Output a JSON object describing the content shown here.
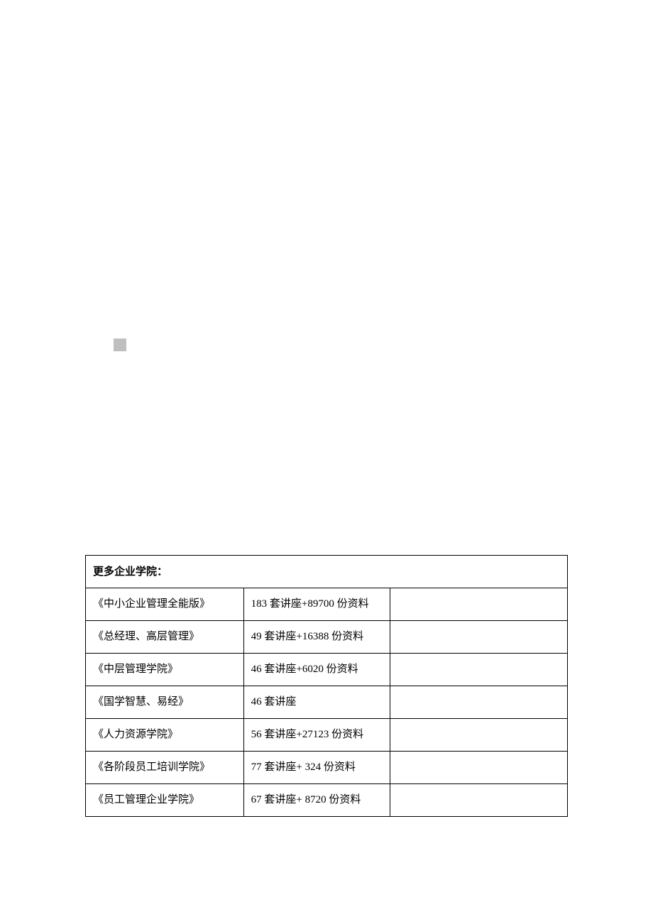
{
  "table": {
    "header": "更多企业学院：",
    "rows": [
      {
        "name": "《中小企业管理全能版》",
        "detail": "183 套讲座+89700 份资料"
      },
      {
        "name": "《总经理、高层管理》",
        "detail": "49 套讲座+16388 份资料"
      },
      {
        "name": "《中层管理学院》",
        "detail": "46 套讲座+6020 份资料"
      },
      {
        "name": "《国学智慧、易经》",
        "detail": "46 套讲座"
      },
      {
        "name": "《人力资源学院》",
        "detail": "56 套讲座+27123 份资料"
      },
      {
        "name": "《各阶段员工培训学院》",
        "detail": "77 套讲座+ 324 份资料"
      },
      {
        "name": "《员工管理企业学院》",
        "detail": "67 套讲座+ 8720 份资料"
      }
    ]
  }
}
